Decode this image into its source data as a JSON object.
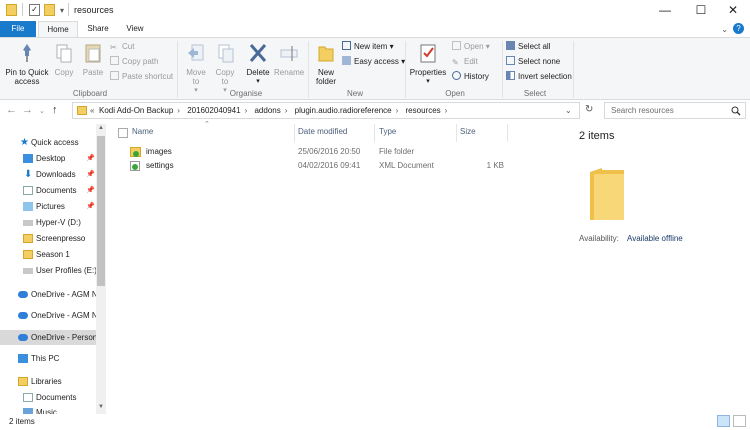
{
  "window": {
    "title": "resources",
    "minimize_glyph": "—",
    "maximize_glyph": "☐",
    "close_glyph": "✕"
  },
  "tabs": [
    "File",
    "Home",
    "Share",
    "View"
  ],
  "help_glyph": "?",
  "ribbon": {
    "clipboard": {
      "label": "Clipboard",
      "pin": "Pin to Quick access",
      "copy": "Copy",
      "paste": "Paste",
      "cut": "Cut",
      "copy_path": "Copy path",
      "paste_shortcut": "Paste shortcut"
    },
    "organise": {
      "label": "Organise",
      "move_to": "Move to",
      "copy_to": "Copy to",
      "delete": "Delete",
      "rename": "Rename"
    },
    "new": {
      "label": "New",
      "new_folder": "New folder",
      "new_item": "New item",
      "easy_access": "Easy access"
    },
    "open": {
      "label": "Open",
      "properties": "Properties",
      "open": "Open",
      "edit": "Edit",
      "history": "History"
    },
    "select": {
      "label": "Select",
      "select_all": "Select all",
      "select_none": "Select none",
      "invert": "Invert selection"
    }
  },
  "address": {
    "crumbs": [
      "Kodi Add-On Backup",
      "201602040941",
      "addons",
      "plugin.audio.radioreference",
      "resources"
    ],
    "search_placeholder": "Search resources"
  },
  "nav": [
    {
      "label": "Quick access",
      "icon": "star-icon"
    },
    {
      "label": "Desktop",
      "icon": "desktop-icon",
      "pinned": true
    },
    {
      "label": "Downloads",
      "icon": "download-icon",
      "pinned": true
    },
    {
      "label": "Documents",
      "icon": "documents-icon",
      "pinned": true
    },
    {
      "label": "Pictures",
      "icon": "pictures-icon",
      "pinned": true
    },
    {
      "label": "Hyper-V (D:)",
      "icon": "drive-icon"
    },
    {
      "label": "Screenpresso",
      "icon": "folder-icon"
    },
    {
      "label": "Season 1",
      "icon": "folder-icon"
    },
    {
      "label": "User Profiles (E:)",
      "icon": "drive-icon"
    },
    {
      "label": "OneDrive - AGM N",
      "icon": "onedrive-icon"
    },
    {
      "label": "OneDrive - AGM N",
      "icon": "onedrive-icon"
    },
    {
      "label": "OneDrive - Person",
      "icon": "onedrive-icon"
    },
    {
      "label": "This PC",
      "icon": "pc-icon"
    },
    {
      "label": "Libraries",
      "icon": "libraries-icon"
    },
    {
      "label": "Documents",
      "icon": "documents-icon"
    },
    {
      "label": "Music",
      "icon": "music-icon"
    }
  ],
  "columns": {
    "name": "Name",
    "date": "Date modified",
    "type": "Type",
    "size": "Size"
  },
  "files": [
    {
      "name": "images",
      "date": "25/06/2016 20:50",
      "type": "File folder",
      "size": "",
      "icon": "folder-sync-icon"
    },
    {
      "name": "settings",
      "date": "04/02/2016 09:41",
      "type": "XML Document",
      "size": "1 KB",
      "icon": "xml-sync-icon"
    }
  ],
  "details": {
    "count": "2 items",
    "availability_label": "Availability:",
    "availability_value": "Available offline"
  },
  "status": {
    "count": "2 items"
  },
  "colors": {
    "accent": "#1979ca",
    "folder": "#f3cf61",
    "sync_green": "#3aa63a"
  }
}
